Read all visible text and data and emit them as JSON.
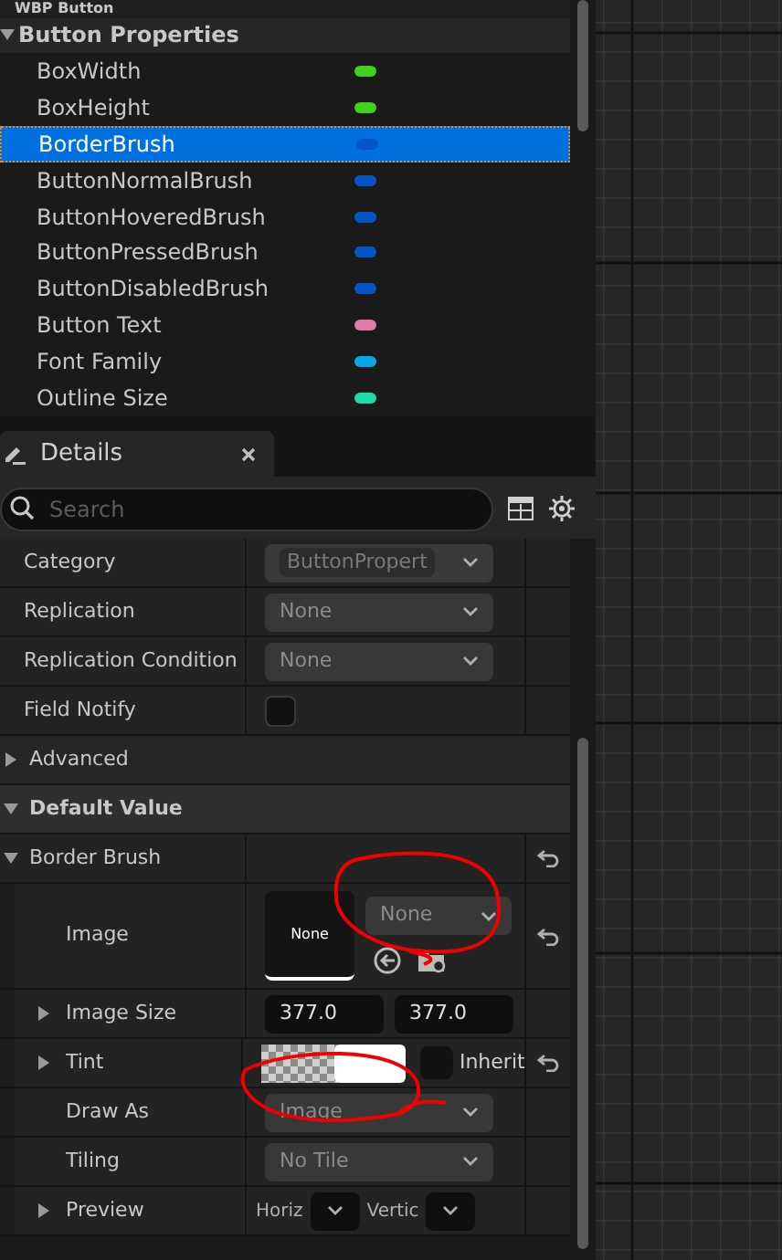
{
  "blueprint": {
    "label": "WBP Button"
  },
  "category": {
    "label": "Button Properties",
    "expanded": true
  },
  "variables": [
    {
      "name": "BoxWidth",
      "color": "#3fd21a",
      "selected": false
    },
    {
      "name": "BoxHeight",
      "color": "#3fd21a",
      "selected": false
    },
    {
      "name": "BorderBrush",
      "color": "#0555c8",
      "selected": true
    },
    {
      "name": "ButtonNormalBrush",
      "color": "#0555c8",
      "selected": false
    },
    {
      "name": "ButtonHoveredBrush",
      "color": "#0555c8",
      "selected": false
    },
    {
      "name": "ButtonPressedBrush",
      "color": "#0555c8",
      "selected": false
    },
    {
      "name": "ButtonDisabledBrush",
      "color": "#0555c8",
      "selected": false
    },
    {
      "name": "Button Text",
      "color": "#e07aa6",
      "selected": false
    },
    {
      "name": "Font Family",
      "color": "#07a8e8",
      "selected": false
    },
    {
      "name": "Outline Size",
      "color": "#1fd8a8",
      "selected": false
    }
  ],
  "details_tab": {
    "label": "Details"
  },
  "search": {
    "placeholder": "Search"
  },
  "properties": [
    {
      "kind": "combo",
      "label": "Category",
      "value": "ButtonPropert",
      "disabled": true
    },
    {
      "kind": "combo",
      "label": "Replication",
      "value": "None",
      "disabled": false
    },
    {
      "kind": "combo",
      "label": "Replication Condition",
      "value": "None",
      "disabled": false
    },
    {
      "kind": "checkbox",
      "label": "Field Notify",
      "checked": false
    },
    {
      "kind": "section",
      "label": "Advanced",
      "expanded": false
    },
    {
      "kind": "section",
      "label": "Default Value",
      "expanded": true
    },
    {
      "kind": "struct",
      "label": "Border Brush",
      "expanded": true,
      "reset": true,
      "children": [
        {
          "kind": "image",
          "label": "Image",
          "thumbnail": "None",
          "value": "None",
          "reset": true
        },
        {
          "kind": "vector",
          "label": "Image Size",
          "expanded": false,
          "values": [
            "377.0",
            "377.0"
          ]
        },
        {
          "kind": "color",
          "label": "Tint",
          "expanded": false,
          "inherit": "Inherit",
          "checked": false,
          "reset": true
        },
        {
          "kind": "combo",
          "label": "Draw As",
          "value": "Image",
          "disabled": false
        },
        {
          "kind": "combo",
          "label": "Tiling",
          "value": "No Tile",
          "disabled": false
        },
        {
          "kind": "preview",
          "label": "Preview",
          "expanded": false,
          "options": [
            "Horiz",
            "Vertic"
          ]
        }
      ]
    }
  ]
}
